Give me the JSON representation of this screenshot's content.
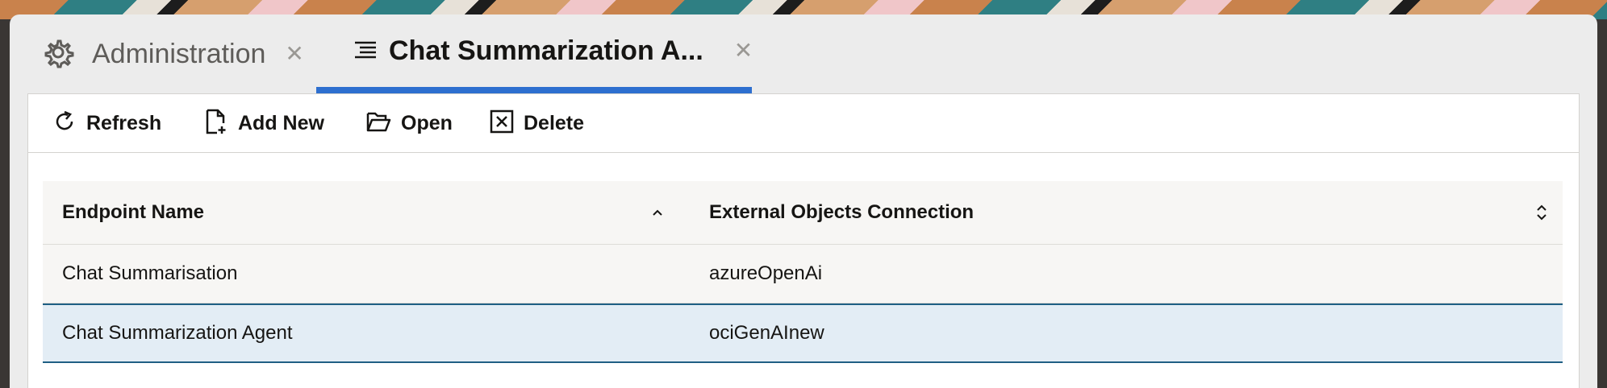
{
  "tabs": [
    {
      "label": "Administration",
      "icon": "gear-icon",
      "active": false
    },
    {
      "label": "Chat Summarization A...",
      "icon": "list-icon",
      "active": true
    }
  ],
  "toolbar": {
    "refresh_label": "Refresh",
    "add_new_label": "Add New",
    "open_label": "Open",
    "delete_label": "Delete"
  },
  "table": {
    "columns": [
      "Endpoint Name",
      "External Objects Connection"
    ],
    "rows": [
      {
        "endpoint_name": "Chat Summarisation",
        "connection": "azureOpenAi",
        "selected": false
      },
      {
        "endpoint_name": "Chat Summarization Agent",
        "connection": "ociGenAInew",
        "selected": true
      }
    ]
  },
  "colors": {
    "accent": "#2e6fcf",
    "selected_row_border": "#1f5f84",
    "selected_row_bg": "#e3edf5"
  }
}
